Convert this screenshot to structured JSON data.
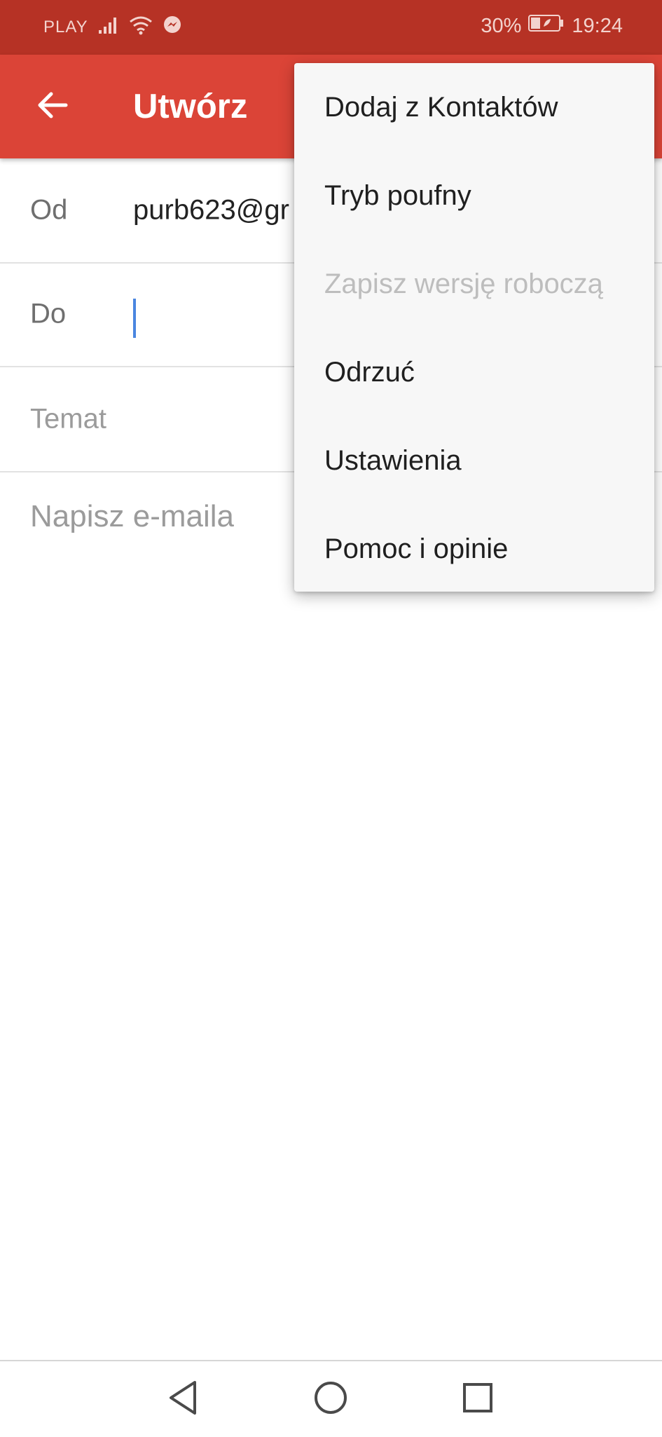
{
  "status_bar": {
    "carrier": "PLAY",
    "battery": "30%",
    "time": "19:24",
    "icons": [
      "signal-icon",
      "wifi-icon",
      "messenger-icon",
      "battery-icon"
    ]
  },
  "app_bar": {
    "title": "Utwórz",
    "back_icon": "arrow-left-icon",
    "color": "#db4437"
  },
  "compose": {
    "from_label": "Od",
    "from_value": "purb623@gr",
    "to_label": "Do",
    "subject_placeholder": "Temat",
    "body_placeholder": "Napisz e-maila"
  },
  "menu": {
    "items": [
      {
        "label": "Dodaj z Kontaktów",
        "enabled": true
      },
      {
        "label": "Tryb poufny",
        "enabled": true
      },
      {
        "label": "Zapisz wersję roboczą",
        "enabled": false
      },
      {
        "label": "Odrzuć",
        "enabled": true
      },
      {
        "label": "Ustawienia",
        "enabled": true
      },
      {
        "label": "Pomoc i opinie",
        "enabled": true
      }
    ]
  },
  "nav_bar": {
    "icons": [
      "back-triangle-icon",
      "home-circle-icon",
      "recents-square-icon"
    ]
  }
}
